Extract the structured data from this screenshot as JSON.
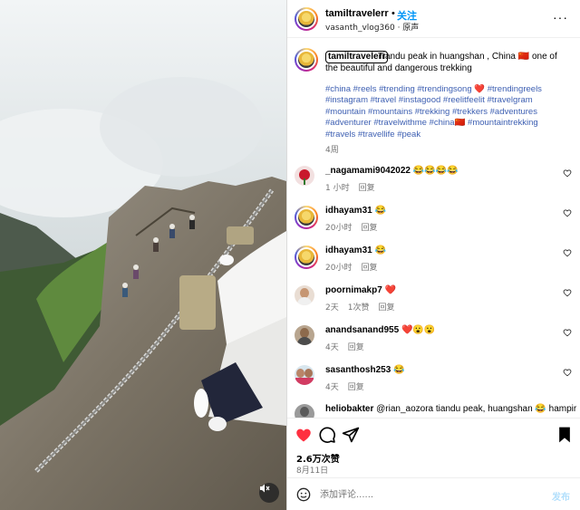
{
  "header": {
    "username": "tamiltravelerr",
    "separator": "•",
    "follow_label": "关注",
    "subtitle": "vasanth_vlog360 · 原声"
  },
  "caption": {
    "username": "tamiltravelerr",
    "text": "Tiandu peak in huangshan , China 🇨🇳 one of the beautiful and dangerous trekking",
    "hashtags": "#china #reels #trending #trendingsong ❤️ #trendingreels #instagram #travel #instagood #reelitfeelit #travelgram #mountain #mountains #trekking #trekkers #adventures #adventurer #travelwithme #china🇨🇳 #mountaintrekking #travels #travellife #peak",
    "time": "4周"
  },
  "comments": [
    {
      "username": "_nagamami9042022",
      "text": "😂😂😂😂",
      "time": "1 小时",
      "likes": "",
      "reply": "回复",
      "avatar": "rose"
    },
    {
      "username": "idhayam31",
      "text": "😂",
      "time": "20小时",
      "likes": "",
      "reply": "回复",
      "avatar": "yellow"
    },
    {
      "username": "idhayam31",
      "text": "😂",
      "time": "20小时",
      "likes": "",
      "reply": "回复",
      "avatar": "yellow"
    },
    {
      "username": "poornimakp7",
      "text": "❤️",
      "time": "2天",
      "likes": "1次赞",
      "reply": "回复",
      "avatar": "woman"
    },
    {
      "username": "anandsanand955",
      "text": "❤️😮😮",
      "time": "4天",
      "likes": "",
      "reply": "回复",
      "avatar": "man"
    },
    {
      "username": "sasanthosh253",
      "text": "😂",
      "time": "4天",
      "likes": "",
      "reply": "回复",
      "avatar": "couple"
    },
    {
      "username": "heliobakter",
      "text": "@rian_aozora tiandu peak, huangshan 😂 hampir",
      "time": "",
      "likes": "",
      "reply": "",
      "avatar": "gray"
    }
  ],
  "actions": {
    "likes": "2.6万次赞",
    "date": "8月11日"
  },
  "composer": {
    "placeholder": "添加评论......",
    "post_label": "发布"
  },
  "colors": {
    "accent_blue": "#0095f6",
    "link_blue": "#00376b",
    "like_red": "#ff3040",
    "muted_gray": "#737373"
  }
}
